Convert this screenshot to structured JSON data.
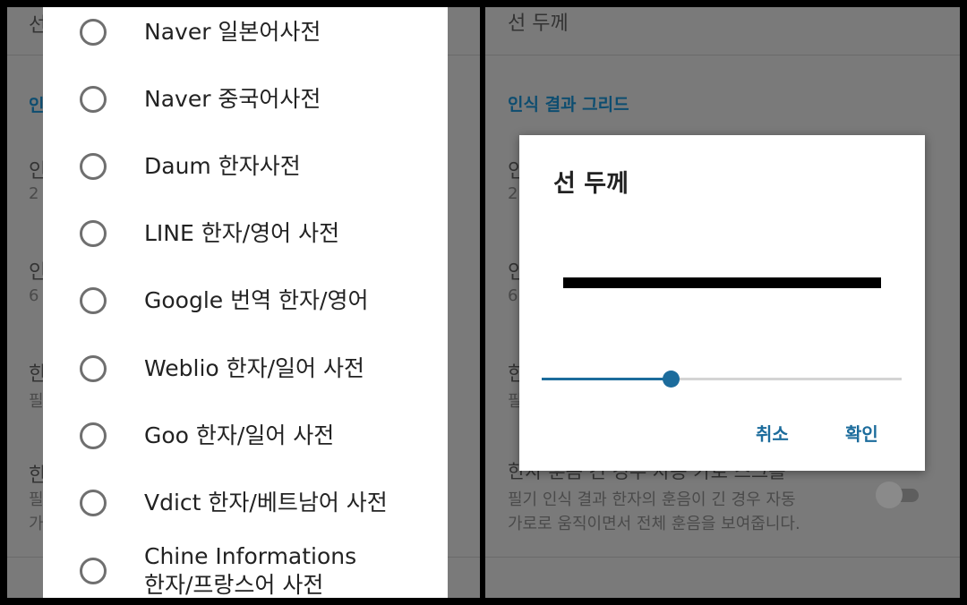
{
  "left": {
    "background": {
      "items": [
        "선",
        "인",
        "인",
        "2",
        "인",
        "6",
        "한",
        "필",
        "한",
        "필",
        "가"
      ]
    },
    "dictionary_options": [
      {
        "label": "Naver 일본어사전"
      },
      {
        "label": "Naver 중국어사전"
      },
      {
        "label": "Daum 한자사전"
      },
      {
        "label": "LINE 한자/영어 사전"
      },
      {
        "label": "Google 번역 한자/영어"
      },
      {
        "label": "Weblio 한자/일어 사전"
      },
      {
        "label": "Goo 한자/일어 사전"
      },
      {
        "label": "Vdict 한자/베트남어 사전"
      },
      {
        "label": "Chine Informations",
        "label2": "한자/프랑스어 사전"
      }
    ]
  },
  "right": {
    "background": {
      "top_item": "선 두께",
      "section_header": "인식 결과 그리드",
      "peek": [
        "인",
        "2",
        "인",
        "6",
        "한",
        "필"
      ],
      "bottom_item_title": "한자 훈음 긴 경우 자동 가로 스크롤",
      "bottom_item_desc1": "필기 인식 결과 한자의 훈음이 긴 경우 자동",
      "bottom_item_desc2": "가로로 움직이면서 전체 훈음을 보여줍니다.",
      "toggle_on": false
    },
    "dialog": {
      "title": "선 두께",
      "slider_value": 0.357,
      "cancel_label": "취소",
      "ok_label": "확인"
    }
  },
  "colors": {
    "accent": "#1c6c9c",
    "dim_background": "#7a7a7a"
  }
}
